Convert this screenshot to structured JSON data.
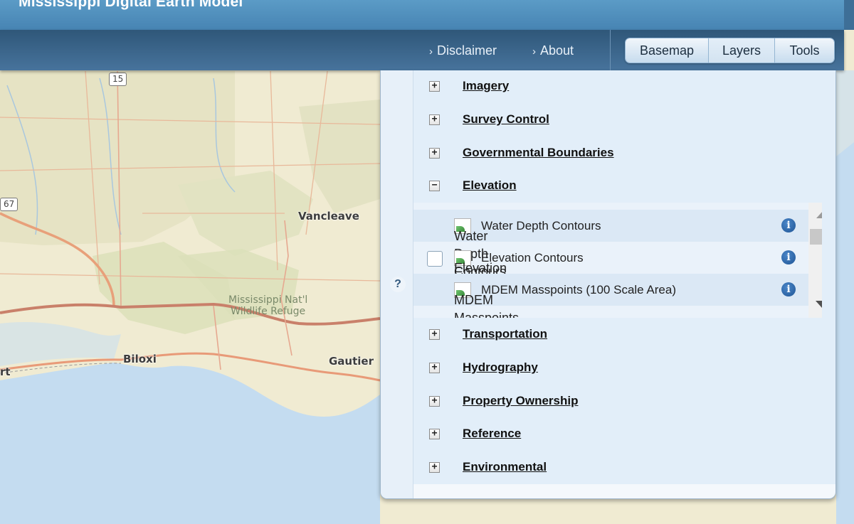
{
  "app": {
    "title": "Mississippi Digital Earth Model"
  },
  "nav": {
    "links": [
      {
        "label": "Disclaimer"
      },
      {
        "label": "About"
      }
    ],
    "chevron": "›",
    "buttons": {
      "basemap": "Basemap",
      "layers": "Layers",
      "tools": "Tools"
    },
    "active_button": "Layers"
  },
  "map": {
    "cities": [
      "Vancleave",
      "Biloxi",
      "Gautier",
      "rt"
    ],
    "refuge": [
      "Mississippi Nat'l",
      "Wildlife Refuge"
    ],
    "shields": [
      "15",
      "67"
    ]
  },
  "panel": {
    "help_label": "?",
    "toggle_plus": "+",
    "toggle_minus": "−",
    "groups": [
      {
        "label": "Imagery",
        "expanded": false
      },
      {
        "label": "Survey Control",
        "expanded": false
      },
      {
        "label": "Governmental Boundaries",
        "expanded": false
      },
      {
        "label": "Elevation",
        "expanded": true
      },
      {
        "label": "Transportation",
        "expanded": false
      },
      {
        "label": "Hydrography",
        "expanded": false
      },
      {
        "label": "Property Ownership",
        "expanded": false
      },
      {
        "label": "Reference",
        "expanded": false
      },
      {
        "label": "Environmental",
        "expanded": false
      }
    ],
    "elevation_layers": [
      {
        "label": "Water Depth Contours",
        "alt_text": "Water Depth Contours",
        "checked": false
      },
      {
        "label": "Elevation Contours",
        "alt_text": "Elevation Contours",
        "checked": false
      },
      {
        "label": "MDEM Masspoints (100 Scale Area)",
        "alt_text": "MDEM Masspoints",
        "checked": false
      }
    ],
    "info_label": "i"
  },
  "colors": {
    "header_top": "#5b9bc6",
    "nav_bar": "#3d6790",
    "panel_bg": "#e2eef9",
    "info_blue": "#1f5595"
  }
}
